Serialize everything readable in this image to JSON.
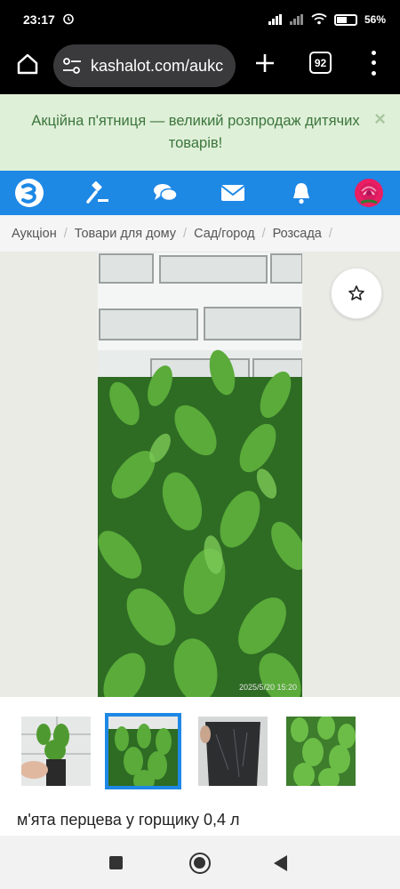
{
  "status_bar": {
    "time": "23:17",
    "battery": "56%",
    "battery_level": 0.56,
    "icons": [
      "alarm-icon",
      "signal-icon",
      "signal-icon",
      "wifi-icon",
      "battery-icon"
    ]
  },
  "browser": {
    "url": "kashalot.com/aukc",
    "tab_count": "92",
    "icons": [
      "home-icon",
      "site-settings-icon",
      "plus-icon",
      "tabs-icon",
      "menu-icon"
    ]
  },
  "promo": {
    "text": "Акційна п'ятниця — великий розпродаж дитячих товарів!",
    "close": "×"
  },
  "navbar": {
    "bg_color": "#1e88e5",
    "icons": [
      "logo-icon",
      "auction-hammer-icon",
      "chat-icon",
      "mail-icon",
      "bell-icon",
      "avatar-rose-icon"
    ]
  },
  "breadcrumb": {
    "items": [
      "Аукціон",
      "Товари для дому",
      "Сад/город",
      "Розсада"
    ],
    "separator": "/"
  },
  "gallery": {
    "photo_stamp": "2025/5/20 15:20",
    "thumbnails": 4,
    "active_thumbnail": 2
  },
  "product": {
    "title": "м'ята перцева у горщику 0,4 л"
  }
}
